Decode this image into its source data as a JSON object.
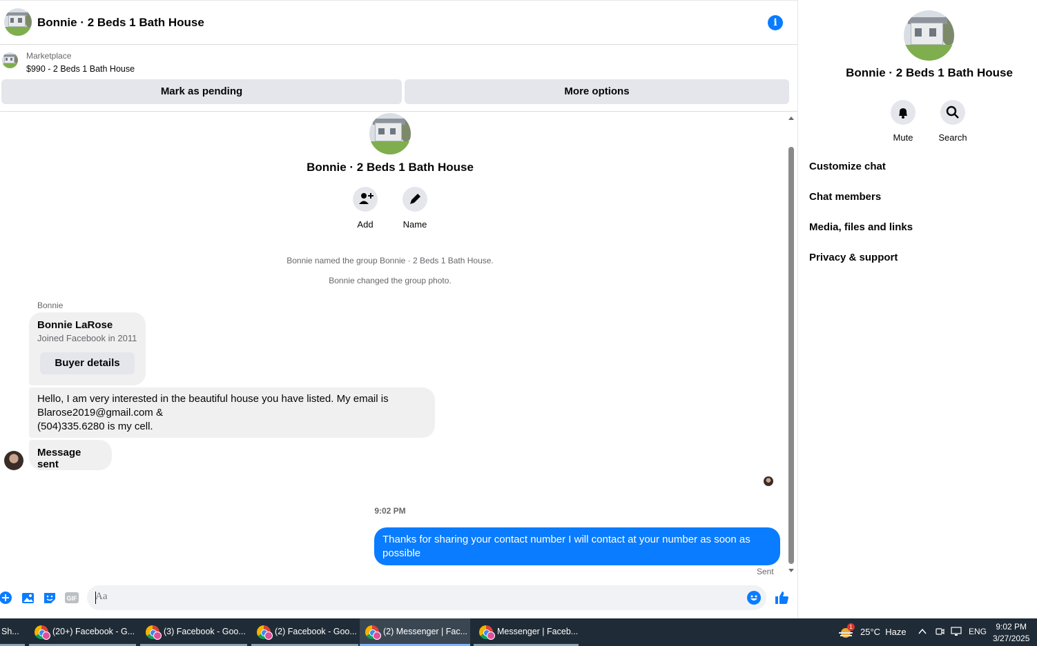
{
  "header": {
    "title": "Bonnie · 2 Beds 1 Bath House"
  },
  "marketplace": {
    "label": "Marketplace",
    "listing": "$990 - 2 Beds 1 Bath House",
    "mark_pending": "Mark as pending",
    "more_options": "More options"
  },
  "thread": {
    "group_title": "Bonnie · 2 Beds 1 Bath House",
    "actions": {
      "add": "Add",
      "name": "Name"
    },
    "system_messages": [
      "Bonnie named the group Bonnie · 2 Beds 1 Bath House.",
      "Bonnie changed the group photo."
    ],
    "sender_name": "Bonnie",
    "buyer_card": {
      "name": "Bonnie LaRose",
      "joined": "Joined Facebook in 2011",
      "button": "Buyer details"
    },
    "incoming_lines": [
      "Hello, I am very interested in the beautiful house you have listed. My email is",
      "Blarose2019@gmail.com &",
      "(504)335.6280 is my cell."
    ],
    "incoming_2": "Message sent",
    "timestamp": "9:02 PM",
    "outgoing": "Thanks for sharing your contact number I will contact at your number as soon as possible",
    "status": "Sent"
  },
  "composer": {
    "placeholder": "Aa"
  },
  "right_panel": {
    "title": "Bonnie · 2 Beds 1 Bath House",
    "mute": "Mute",
    "search": "Search",
    "menu": [
      "Customize chat",
      "Chat members",
      "Media, files and links",
      "Privacy & support"
    ]
  },
  "taskbar": {
    "start_label": "Sh...",
    "items": [
      "(20+) Facebook - G...",
      "(3) Facebook - Goo...",
      "(2) Facebook - Goo...",
      "(2) Messenger | Fac...",
      "Messenger | Faceb..."
    ],
    "weather_badge": "1",
    "weather": "25°C  Haze",
    "lang": "ENG",
    "time": "9:02 PM",
    "date": "3/27/2025"
  },
  "colors": {
    "accent": "#0a7cff",
    "bubble_in": "#f0f0f0",
    "taskbar": "#1f2b36"
  }
}
